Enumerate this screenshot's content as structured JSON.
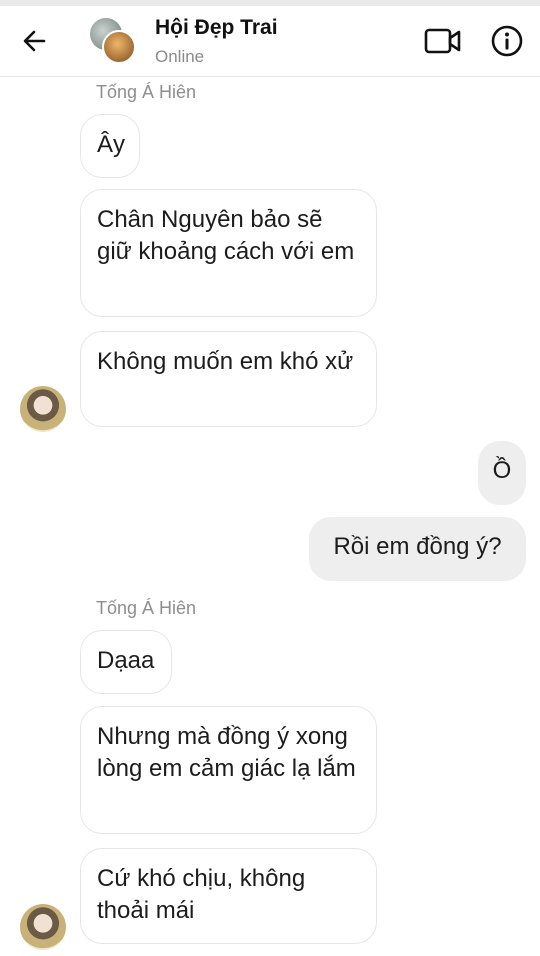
{
  "header": {
    "title": "Hội Đẹp Trai",
    "status": "Online"
  },
  "messages": {
    "sender_1": "Tống Á Hiên",
    "msg_1": "Ây",
    "msg_2": "Chân Nguyên bảo sẽ giữ khoảng cách với em",
    "msg_3": "Không muốn em khó xử",
    "reply_1": "Ồ",
    "reply_2": "Rồi em đồng ý?",
    "sender_2": "Tống Á Hiên",
    "msg_4": "Dạaa",
    "msg_5": "Nhưng mà đồng ý xong lòng em cảm giác lạ lắm",
    "msg_6": "Cứ khó chịu, không thoải mái"
  },
  "icons": {
    "back": "arrow-left-icon",
    "video": "video-camera-icon",
    "info": "info-icon"
  },
  "colors": {
    "outgoing_bubble": "#eeeeee",
    "incoming_bubble": "#ffffff",
    "muted_text": "#8e8e8e"
  }
}
